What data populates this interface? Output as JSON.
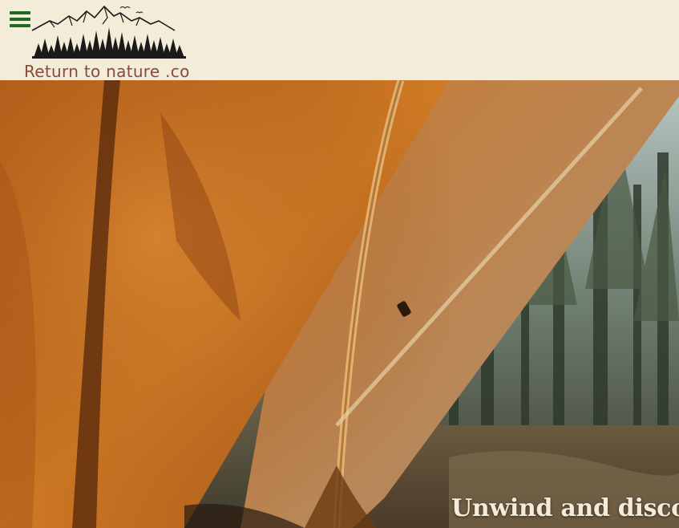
{
  "header": {
    "menu_icon": "hamburger-menu-icon",
    "logo_text": "Return to nature .co",
    "logo_icon": "mountains-forest-logo"
  },
  "hero": {
    "title": "Unwind and discon"
  },
  "colors": {
    "header_bg": "#f2ecd8",
    "menu_icon": "#1e6a1e",
    "logo_text": "#8a4a3a",
    "tent_orange": "#c8741e"
  }
}
